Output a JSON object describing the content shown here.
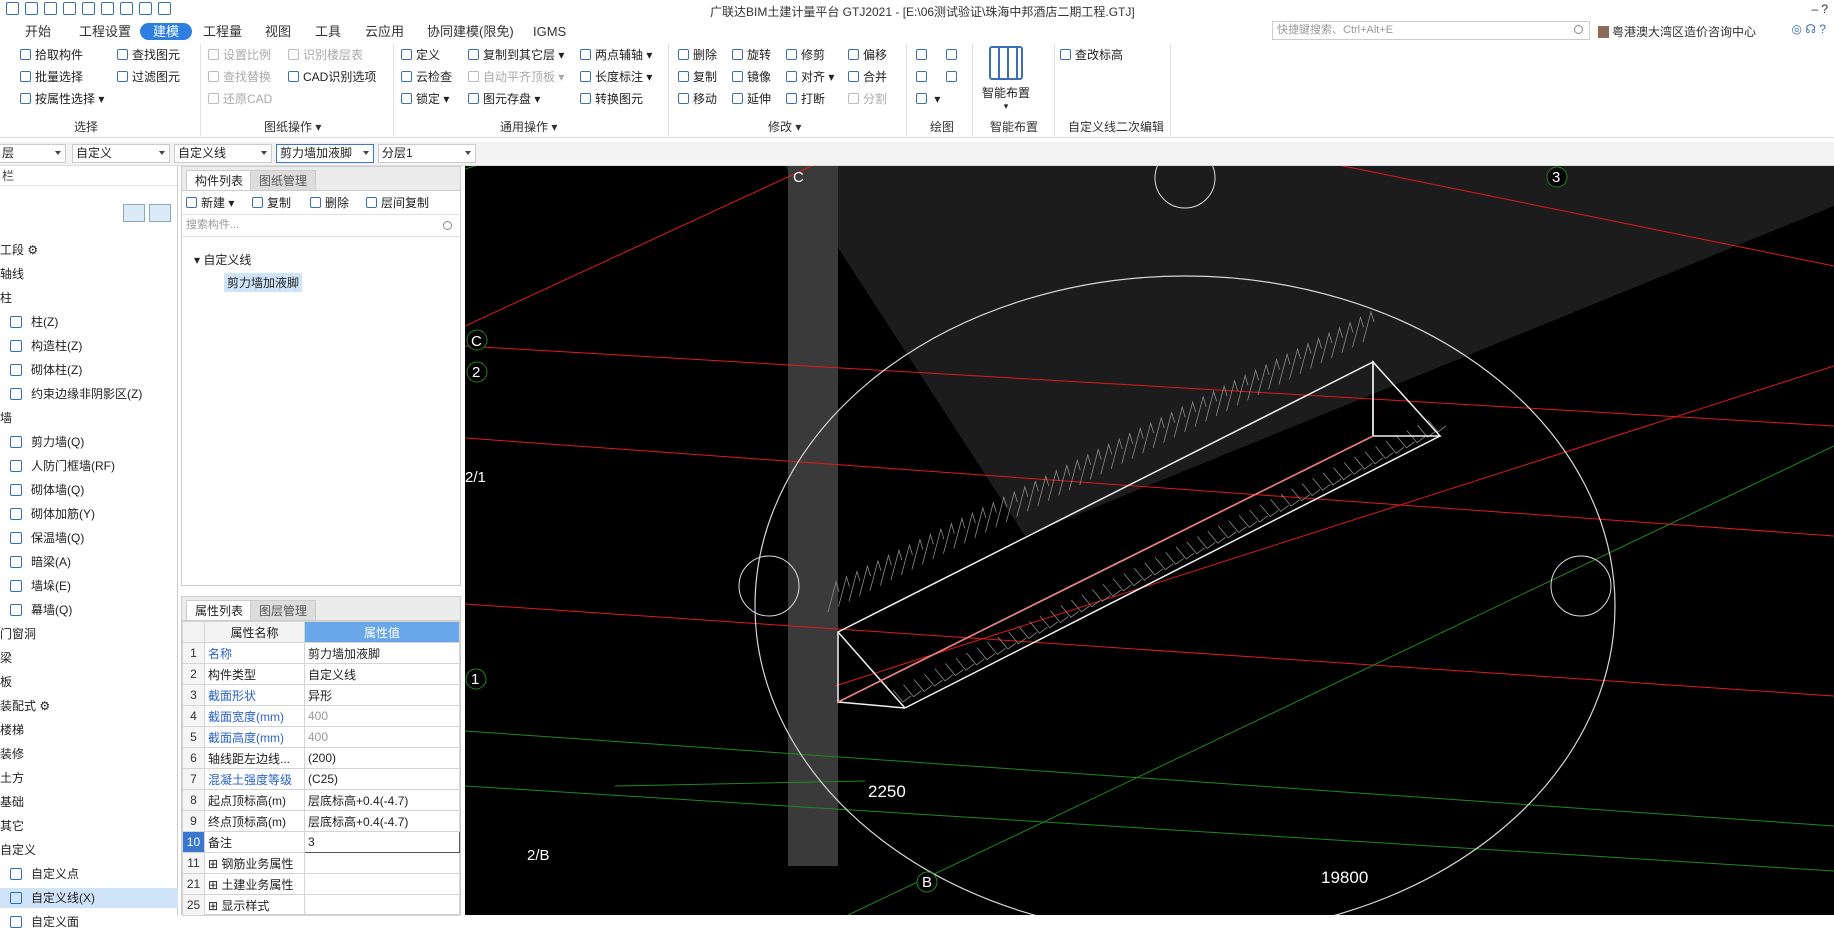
{
  "app": {
    "title": "广联达BIM土建计量平台 GTJ2021 - [E:\\06测试验证\\珠海中邦酒店二期工程.GTJ]",
    "window_controls": "– ?"
  },
  "menu": {
    "tabs": [
      "开始",
      "工程设置",
      "建模",
      "工程量",
      "视图",
      "工具",
      "云应用",
      "协同建模(限免)",
      "IGMS"
    ],
    "active": "建模"
  },
  "quick_search": {
    "placeholder": "快捷键搜索、Ctrl+Alt+E"
  },
  "user": {
    "name": "粤港澳大湾区造价咨询中心"
  },
  "ribbon": {
    "select": {
      "pick": "拾取构件",
      "batch": "批量选择",
      "by_attr": "按属性选择",
      "find": "查找图元",
      "filter": "过滤图元",
      "group": "选择"
    },
    "drawing_ops": {
      "scale": "设置比例",
      "identify_floor": "识别楼层表",
      "find_replace": "查找替换",
      "cad_options": "CAD识别选项",
      "restore_cad": "还原CAD",
      "group": "图纸操作"
    },
    "general_ops": {
      "define": "定义",
      "copy_floor": "复制到其它层",
      "two_point_axis": "两点辅轴",
      "cloud_check": "云检查",
      "auto_flush": "自动平齐顶板",
      "length_dim": "长度标注",
      "lock": "锁定",
      "element_save": "图元存盘",
      "convert": "转换图元",
      "group": "通用操作"
    },
    "modify": {
      "delete": "删除",
      "rotate": "旋转",
      "trim": "修剪",
      "offset": "偏移",
      "copy": "复制",
      "mirror": "镜像",
      "align": "对齐",
      "merge": "合并",
      "move": "移动",
      "extend": "延伸",
      "break": "打断",
      "split": "分割",
      "group": "修改"
    },
    "draw": {
      "group": "绘图"
    },
    "smart": {
      "label": "智能布置",
      "group": "智能布置"
    },
    "custom_line": {
      "label": "查改标高",
      "group": "自定义线二次编辑"
    }
  },
  "toolbar2": {
    "floor": "层",
    "type": "自定义",
    "subtype": "自定义线",
    "component": "剪力墙加液脚",
    "layer": "分层1"
  },
  "nav": {
    "header": "栏",
    "items": [
      {
        "label": "工段 ⚙",
        "type": "cat"
      },
      {
        "label": "轴线",
        "type": "cat"
      },
      {
        "label": "柱",
        "type": "cat"
      },
      {
        "label": "柱(Z)",
        "type": "sub"
      },
      {
        "label": "构造柱(Z)",
        "type": "sub"
      },
      {
        "label": "砌体柱(Z)",
        "type": "sub"
      },
      {
        "label": "约束边缘非阴影区(Z)",
        "type": "sub"
      },
      {
        "label": "墙",
        "type": "cat"
      },
      {
        "label": "剪力墙(Q)",
        "type": "sub"
      },
      {
        "label": "人防门框墙(RF)",
        "type": "sub"
      },
      {
        "label": "砌体墙(Q)",
        "type": "sub"
      },
      {
        "label": "砌体加筋(Y)",
        "type": "sub"
      },
      {
        "label": "保温墙(Q)",
        "type": "sub"
      },
      {
        "label": "暗梁(A)",
        "type": "sub"
      },
      {
        "label": "墙垛(E)",
        "type": "sub"
      },
      {
        "label": "幕墙(Q)",
        "type": "sub"
      },
      {
        "label": "门窗洞",
        "type": "cat"
      },
      {
        "label": "梁",
        "type": "cat"
      },
      {
        "label": "板",
        "type": "cat"
      },
      {
        "label": "装配式 ⚙",
        "type": "cat"
      },
      {
        "label": "楼梯",
        "type": "cat"
      },
      {
        "label": "装修",
        "type": "cat"
      },
      {
        "label": "土方",
        "type": "cat"
      },
      {
        "label": "基础",
        "type": "cat"
      },
      {
        "label": "其它",
        "type": "cat"
      },
      {
        "label": "自定义",
        "type": "cat"
      },
      {
        "label": "自定义点",
        "type": "sub"
      },
      {
        "label": "自定义线(X)",
        "type": "sub",
        "selected": true
      },
      {
        "label": "自定义面",
        "type": "sub"
      }
    ]
  },
  "component_panel": {
    "tabs": [
      "构件列表",
      "图纸管理"
    ],
    "active": "构件列表",
    "toolbar": {
      "new": "新建",
      "copy": "复制",
      "delete": "删除",
      "floor_copy": "层间复制"
    },
    "search_placeholder": "搜索构件...",
    "tree": {
      "parent": "自定义线",
      "child": "剪力墙加液脚"
    }
  },
  "property_panel": {
    "tabs": [
      "属性列表",
      "图层管理"
    ],
    "active": "属性列表",
    "columns": [
      "属性名称",
      "属性值"
    ],
    "rows": [
      {
        "n": "1",
        "name": "名称",
        "value": "剪力墙加液脚",
        "blue": true
      },
      {
        "n": "2",
        "name": "构件类型",
        "value": "自定义线",
        "blue": false
      },
      {
        "n": "3",
        "name": "截面形状",
        "value": "异形",
        "blue": true
      },
      {
        "n": "4",
        "name": "截面宽度(mm)",
        "value": "400",
        "blue": true,
        "gray": true
      },
      {
        "n": "5",
        "name": "截面高度(mm)",
        "value": "400",
        "blue": true,
        "gray": true
      },
      {
        "n": "6",
        "name": "轴线距左边线...",
        "value": "(200)",
        "blue": false
      },
      {
        "n": "7",
        "name": "混凝土强度等级",
        "value": "(C25)",
        "blue": true
      },
      {
        "n": "8",
        "name": "起点顶标高(m)",
        "value": "层底标高+0.4(-4.7)",
        "blue": false
      },
      {
        "n": "9",
        "name": "终点顶标高(m)",
        "value": "层底标高+0.4(-4.7)",
        "blue": false
      },
      {
        "n": "10",
        "name": "备注",
        "value": "3",
        "blue": false,
        "editing": true
      },
      {
        "n": "11",
        "name": "⊞ 钢筋业务属性",
        "value": "",
        "blue": false
      },
      {
        "n": "21",
        "name": "⊞ 土建业务属性",
        "value": "",
        "blue": false
      },
      {
        "n": "25",
        "name": "⊞ 显示样式",
        "value": "",
        "blue": false
      }
    ]
  },
  "viewport": {
    "axis_labels": {
      "c_top": "C",
      "three": "3",
      "c_left": "C",
      "two": "2",
      "two_one": "2/1",
      "one": "1",
      "two_b": "2/B",
      "b": "B"
    },
    "dims": {
      "d1": "2250",
      "d2": "19800"
    },
    "colors": {
      "bg": "#000000",
      "red_axis": "#e01a1a",
      "green_axis": "#1c8a1c",
      "white_line": "#e8e8e8"
    }
  }
}
